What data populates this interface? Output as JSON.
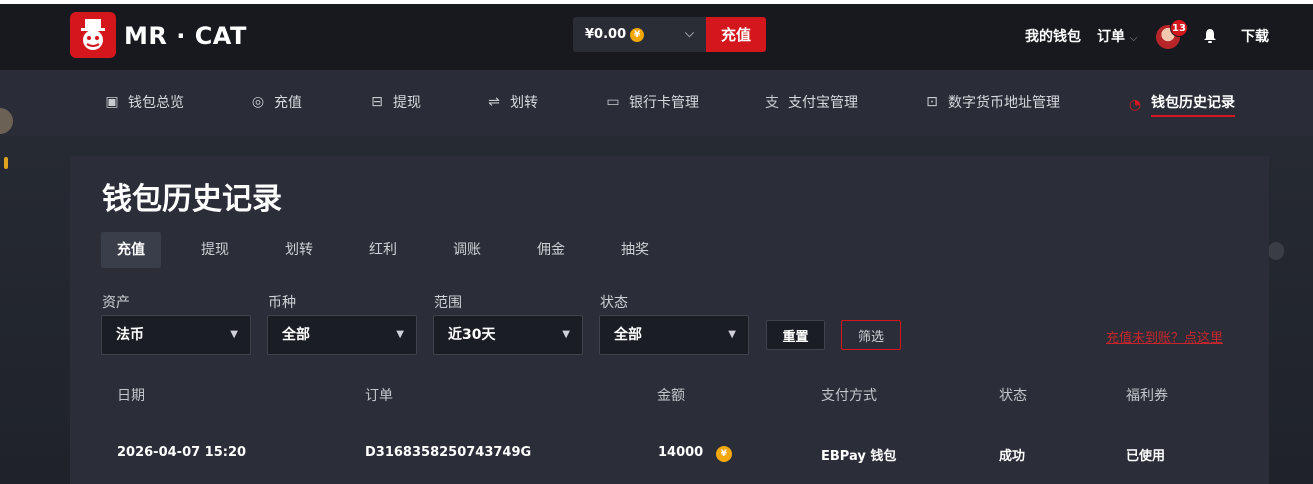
{
  "brand": {
    "name": "MR · CAT",
    "accent": "#d4171c"
  },
  "header": {
    "balance": "¥0.00",
    "coin_symbol": "¥",
    "recharge_label": "充值",
    "my_wallet": "我的钱包",
    "orders": "订单",
    "notification_count": "13",
    "download": "下载"
  },
  "nav": {
    "items": [
      {
        "label": "钱包总览",
        "icon": "wallet-icon"
      },
      {
        "label": "充值",
        "icon": "recharge-icon"
      },
      {
        "label": "提现",
        "icon": "withdraw-icon"
      },
      {
        "label": "划转",
        "icon": "transfer-icon"
      },
      {
        "label": "银行卡管理",
        "icon": "bank-card-icon"
      },
      {
        "label": "支付宝管理",
        "icon": "alipay-icon"
      },
      {
        "label": "数字货币地址管理",
        "icon": "crypto-address-icon"
      },
      {
        "label": "钱包历史记录",
        "icon": "history-icon",
        "active": true
      }
    ]
  },
  "page": {
    "title": "钱包历史记录",
    "tabs": [
      "充值",
      "提现",
      "划转",
      "红利",
      "调账",
      "佣金",
      "抽奖"
    ],
    "active_tab": "充值"
  },
  "filters": {
    "asset": {
      "label": "资产",
      "value": "法币"
    },
    "currency": {
      "label": "币种",
      "value": "全部"
    },
    "range": {
      "label": "范围",
      "value": "近30天"
    },
    "status": {
      "label": "状态",
      "value": "全部"
    },
    "reset_label": "重置",
    "filter_label": "筛选",
    "help_link": "充值未到账？点这里"
  },
  "table": {
    "columns": [
      "日期",
      "订单",
      "金额",
      "支付方式",
      "状态",
      "福利券"
    ],
    "rows": [
      {
        "date": "2026-04-07 15:20",
        "order": "D3168358250743749G",
        "amount": "14000",
        "method": "EBPay 钱包",
        "status": "成功",
        "coupon": "已使用"
      }
    ]
  }
}
